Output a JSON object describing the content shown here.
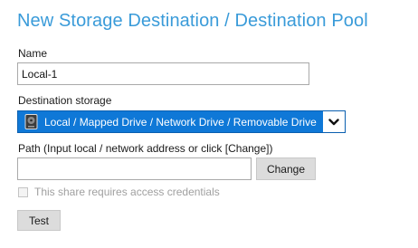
{
  "page": {
    "title": "New Storage Destination / Destination Pool"
  },
  "name_field": {
    "label": "Name",
    "value": "Local-1"
  },
  "destination_storage": {
    "label": "Destination storage",
    "selected": "Local / Mapped Drive / Network Drive / Removable Drive",
    "icon": "drive-icon",
    "highlight_color": "#0f78d7"
  },
  "path_field": {
    "label": "Path (Input local / network address or click [Change])",
    "value": "",
    "change_label": "Change"
  },
  "credentials_checkbox": {
    "label": "This share requires access credentials",
    "checked": false,
    "disabled": true
  },
  "test_button": {
    "label": "Test"
  },
  "colors": {
    "title": "#3a9bd9",
    "button_bg": "#dcdcdc"
  }
}
